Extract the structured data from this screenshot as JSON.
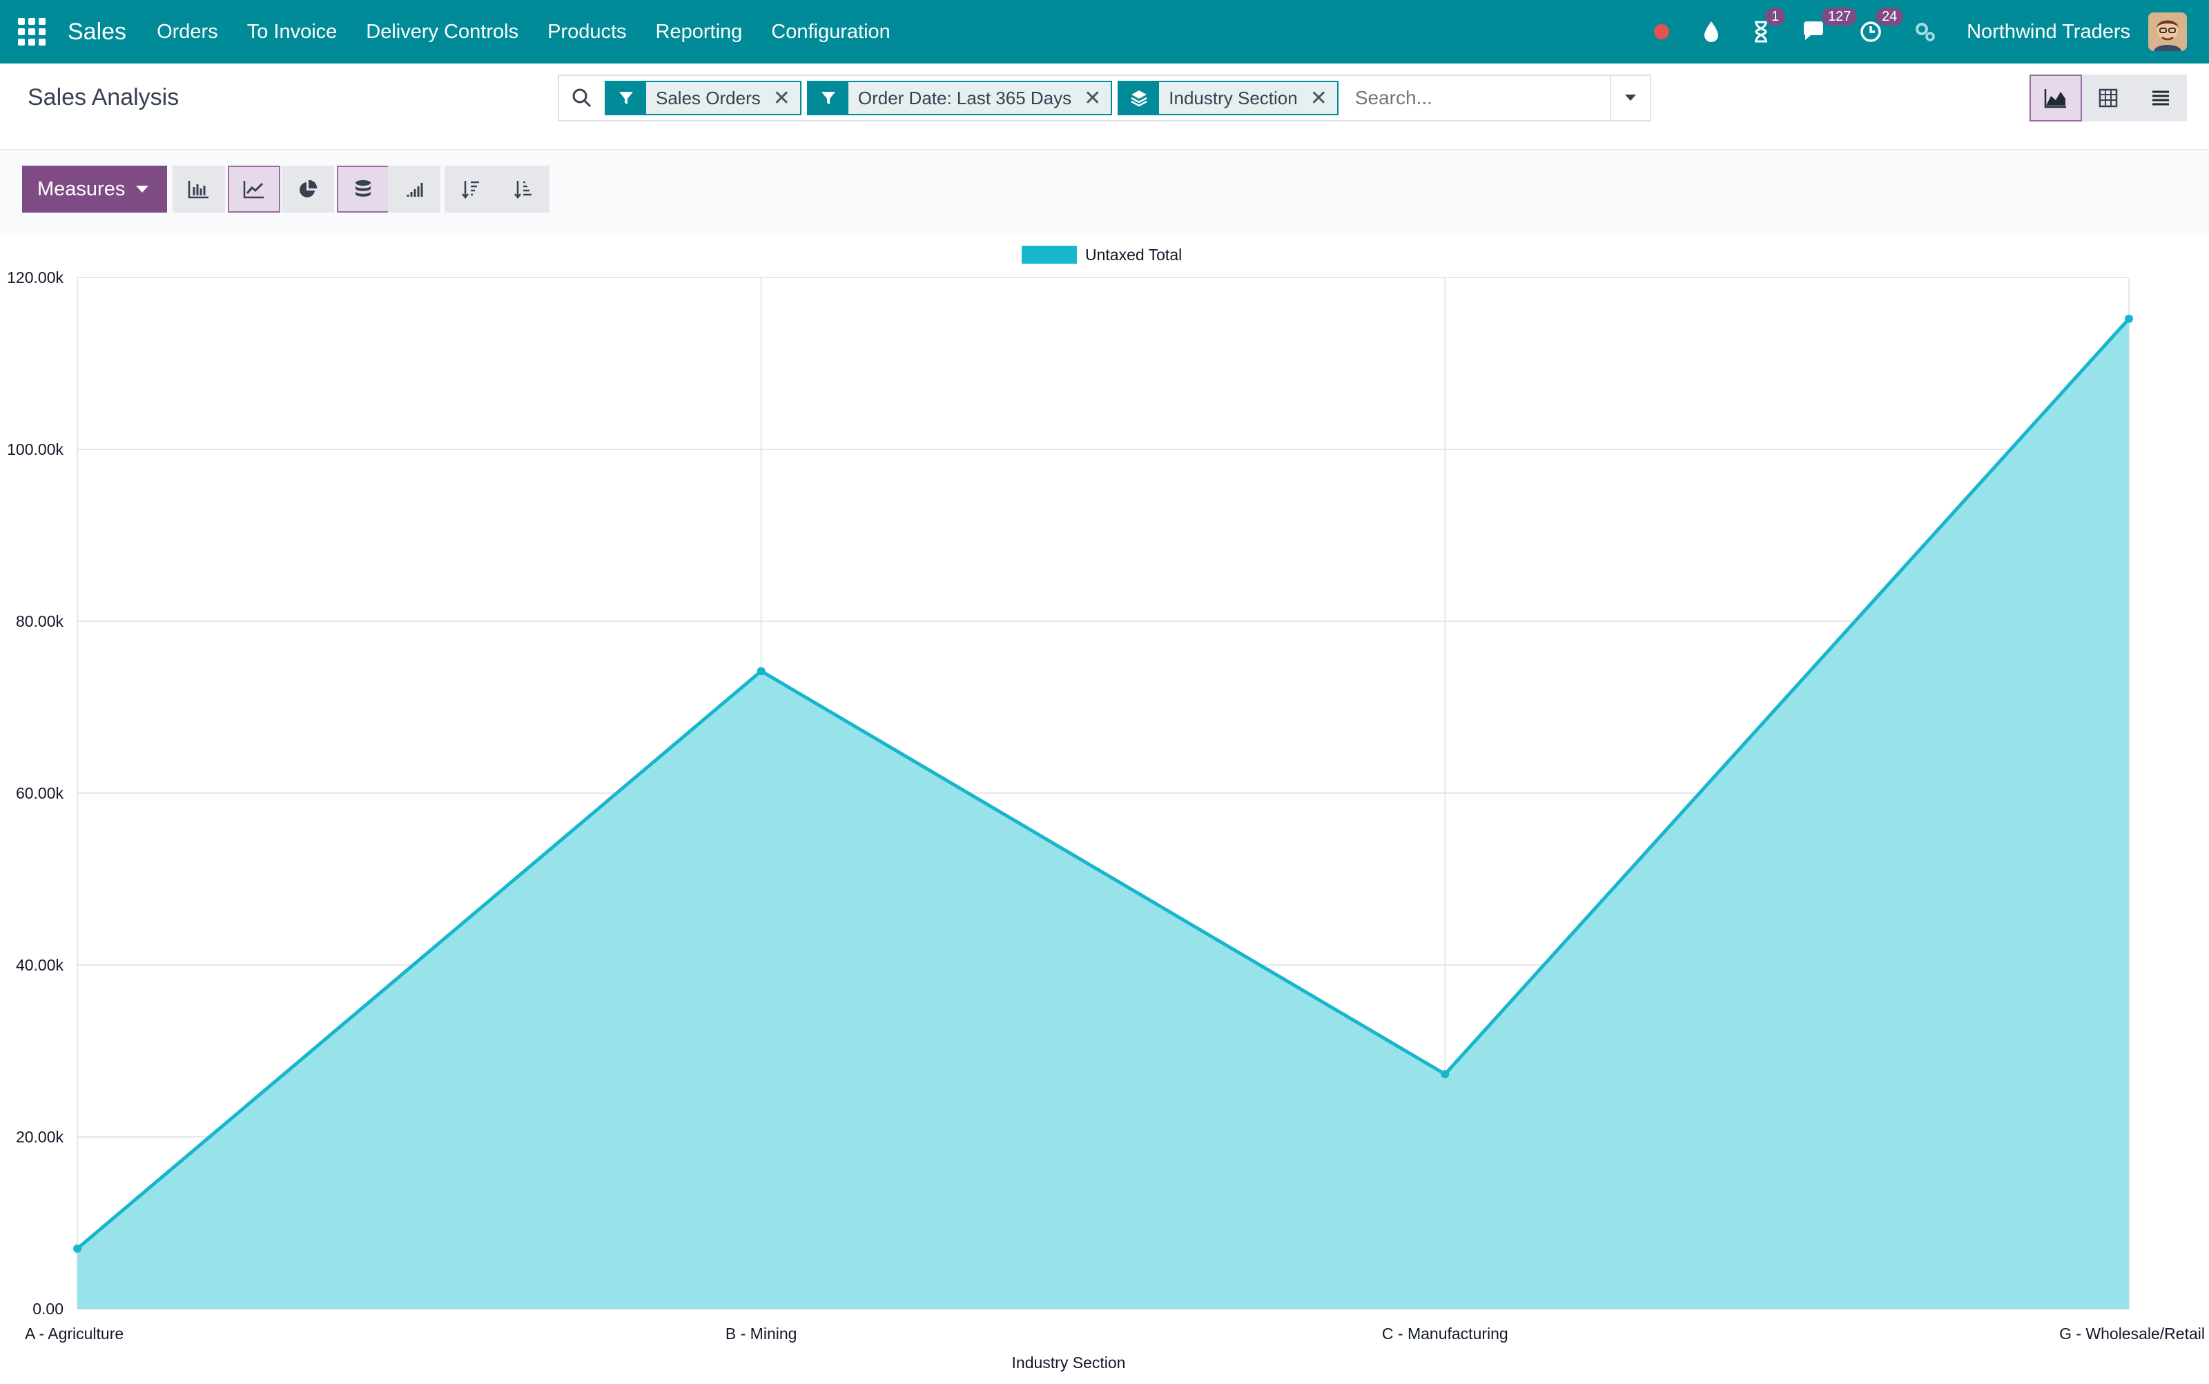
{
  "navbar": {
    "app_name": "Sales",
    "menu": [
      "Orders",
      "To Invoice",
      "Delivery Controls",
      "Products",
      "Reporting",
      "Configuration"
    ],
    "badges": {
      "activities": "1",
      "messages": "127",
      "clock": "24"
    },
    "company": "Northwind Traders",
    "icons": [
      "apps-grid-icon",
      "recording-dot-icon",
      "drop-icon",
      "hourglass-icon",
      "chat-icon",
      "clock-icon",
      "settings-cogs-icon"
    ]
  },
  "control_panel": {
    "title": "Sales Analysis",
    "facets": [
      {
        "type": "filter",
        "label": "Sales Orders"
      },
      {
        "type": "filter",
        "label": "Order Date: Last 365 Days"
      },
      {
        "type": "groupby",
        "label": "Industry Section"
      }
    ],
    "search_placeholder": "Search...",
    "measures_label": "Measures",
    "active_view": "graph",
    "active_chart_type": "line",
    "stacked": true
  },
  "colors": {
    "navbar": "#018a98",
    "accent": "#7e4b85",
    "series_line": "#17b6cc",
    "series_fill": "#98e3ea"
  },
  "chart_data": {
    "type": "area",
    "categories": [
      "A - Agriculture",
      "B - Mining",
      "C - Manufacturing",
      "G - Wholesale/Retail"
    ],
    "series": [
      {
        "name": "Untaxed Total",
        "values": [
          7000,
          74200,
          27300,
          115200
        ]
      }
    ],
    "xlabel": "Industry Section",
    "ylabel": "",
    "ylim": [
      0,
      120000
    ],
    "yticks": [
      "0.00",
      "20.00k",
      "40.00k",
      "60.00k",
      "80.00k",
      "100.00k",
      "120.00k"
    ],
    "legend_position": "top-center",
    "grid": true
  }
}
